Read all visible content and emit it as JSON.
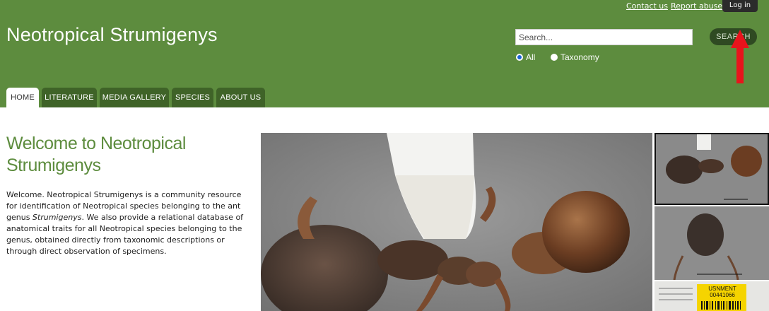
{
  "header": {
    "site_title": "Neotropical Strumigenys",
    "links": {
      "contact": "Contact us",
      "report": "Report abuse",
      "login": "Log in"
    },
    "search": {
      "placeholder": "Search...",
      "button": "SEARCH"
    },
    "search_scope": {
      "all": "All",
      "taxonomy": "Taxonomy",
      "selected": "All"
    }
  },
  "nav": {
    "tabs": [
      {
        "label": "HOME",
        "active": true
      },
      {
        "label": "LITERATURE",
        "active": false
      },
      {
        "label": "MEDIA GALLERY",
        "active": false
      },
      {
        "label": "SPECIES",
        "active": false
      },
      {
        "label": "ABOUT US",
        "active": false
      }
    ]
  },
  "content": {
    "title": "Welcome to Neotropical Strumigenys",
    "intro_before": "Welcome. Neotropical Strumigenys is a community resource for identification of Neotropical species belonging to the ant genus ",
    "intro_italic": "Strumigenys",
    "intro_after": ". We also provide a relational database of anatomical traits for all Neotropical species belonging to the genus, obtained directly from taxonomic descriptions or through direct observation of specimens."
  },
  "gallery": {
    "thumb_label": "USNMENT 00441066"
  },
  "colors": {
    "header_bg": "#5d8c3e",
    "tab_bg": "#3f6328",
    "search_button_bg": "#2f4a22",
    "title_green": "#5d8c3e",
    "annotation_arrow": "#e8141c"
  }
}
